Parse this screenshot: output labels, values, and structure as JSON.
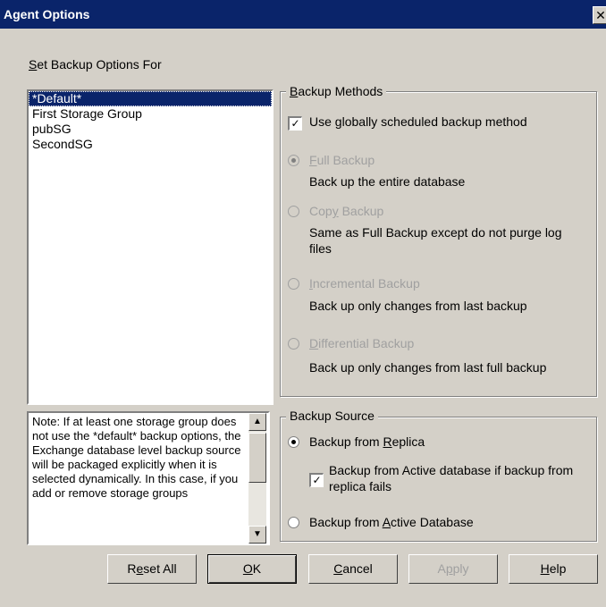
{
  "window": {
    "title": "Agent Options",
    "close": "✕"
  },
  "set_backup_label": {
    "accel": "S",
    "rest": "et Backup Options For"
  },
  "storage_groups": [
    "*Default*",
    "First Storage Group",
    "pubSG",
    "SecondSG"
  ],
  "note_text": "Note: If at least one storage group does not use the *default* backup options, the Exchange database level backup source will be packaged explicitly when it is selected dynamically. In this case, if you add or remove storage groups",
  "backup_methods": {
    "title_accel": "B",
    "title_rest": "ackup Methods",
    "use_global_pre": "Use ",
    "use_global_accel": "g",
    "use_global_post": "lobally scheduled backup method",
    "use_global_checked": true,
    "full": {
      "accel": "F",
      "rest": "ull Backup",
      "desc": "Back up the entire database",
      "selected": true
    },
    "copy": {
      "pre": "Cop",
      "accel": "y",
      "post": " Backup",
      "desc_line1": "Same as Full Backup except do not purge log",
      "desc_line2": "files",
      "selected": false
    },
    "incremental": {
      "accel": "I",
      "rest": "ncremental Backup",
      "desc": "Back up only changes from last backup",
      "selected": false
    },
    "differential": {
      "accel": "D",
      "rest": "ifferential Backup",
      "desc": "Back up only changes from last full backup",
      "selected": false
    }
  },
  "backup_source": {
    "title": "Backup Source",
    "replica_pre": "Backup from ",
    "replica_accel": "R",
    "replica_post": "eplica",
    "replica_selected": true,
    "fallback_line1": "Backup from Active database if backup from",
    "fallback_line2": "replica fails",
    "fallback_checked": true,
    "active_pre": "Backup from ",
    "active_accel": "A",
    "active_post": "ctive Database",
    "active_selected": false
  },
  "buttons": {
    "reset": {
      "pre": "R",
      "accel": "e",
      "post": "set All"
    },
    "ok": {
      "accel": "O",
      "post": "K"
    },
    "cancel": {
      "accel": "C",
      "post": "ancel"
    },
    "apply": {
      "pre": "A",
      "accel": "p",
      "post": "ply"
    },
    "help": {
      "accel": "H",
      "post": "elp"
    }
  },
  "icons": {
    "close": "close-icon",
    "check": "check-icon",
    "scroll_up": "scroll-up-icon",
    "scroll_down": "scroll-down-icon"
  }
}
